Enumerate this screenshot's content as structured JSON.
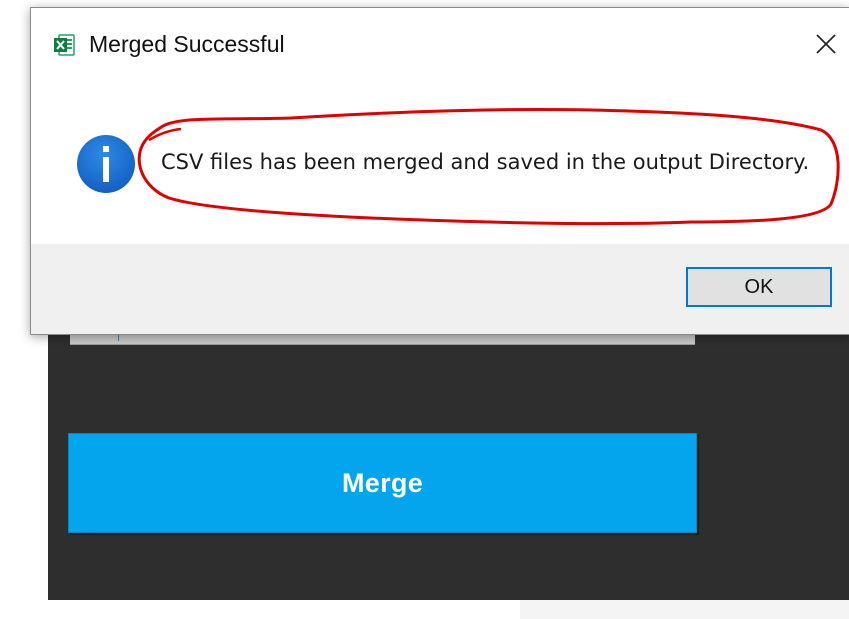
{
  "background_app": {
    "merge_button_label": "Merge",
    "colors": {
      "panel": "#2e2e2e",
      "merge_button": "#04a5ec"
    }
  },
  "dialog": {
    "title": "Merged Successful",
    "app_icon": "excel-icon",
    "close_icon": "close-icon",
    "info_icon": "info-icon",
    "message": "CSV files has been merged and saved in the output Directory.",
    "ok_label": "OK",
    "colors": {
      "ok_border": "#0078d7",
      "info_icon": "#1e73d2",
      "annotation": "#e00000"
    }
  }
}
